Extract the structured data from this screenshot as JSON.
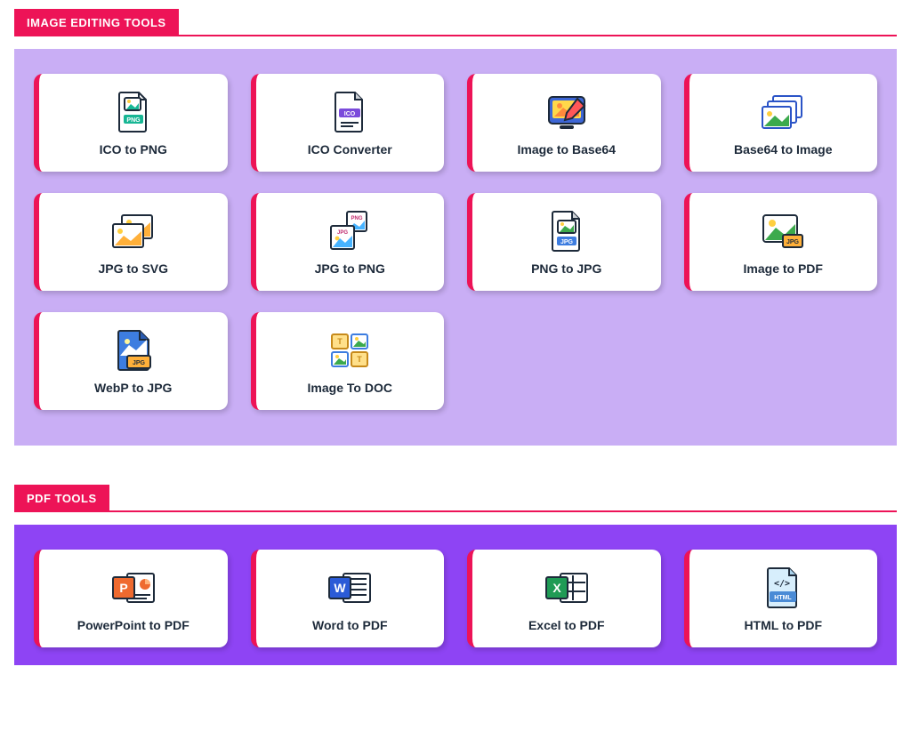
{
  "sections": [
    {
      "title": "IMAGE EDITING TOOLS",
      "panel_style": "light",
      "items": [
        {
          "label": "ICO to PNG",
          "icon": "png-file-icon"
        },
        {
          "label": "ICO Converter",
          "icon": "ico-file-icon"
        },
        {
          "label": "Image to Base64",
          "icon": "image-edit-icon"
        },
        {
          "label": "Base64 to Image",
          "icon": "images-stack-icon"
        },
        {
          "label": "JPG to SVG",
          "icon": "images-stack-alt-icon"
        },
        {
          "label": "JPG to PNG",
          "icon": "jpg-png-convert-icon"
        },
        {
          "label": "PNG to JPG",
          "icon": "jpg-file-icon"
        },
        {
          "label": "Image to PDF",
          "icon": "image-jpg-badge-icon"
        },
        {
          "label": "WebP to JPG",
          "icon": "webp-jpg-icon"
        },
        {
          "label": "Image To DOC",
          "icon": "image-doc-grid-icon"
        }
      ]
    },
    {
      "title": "PDF TOOLS",
      "panel_style": "dark",
      "items": [
        {
          "label": "PowerPoint to PDF",
          "icon": "powerpoint-icon"
        },
        {
          "label": "Word to PDF",
          "icon": "word-icon"
        },
        {
          "label": "Excel to PDF",
          "icon": "excel-icon"
        },
        {
          "label": "HTML to PDF",
          "icon": "html-file-icon"
        }
      ]
    }
  ]
}
